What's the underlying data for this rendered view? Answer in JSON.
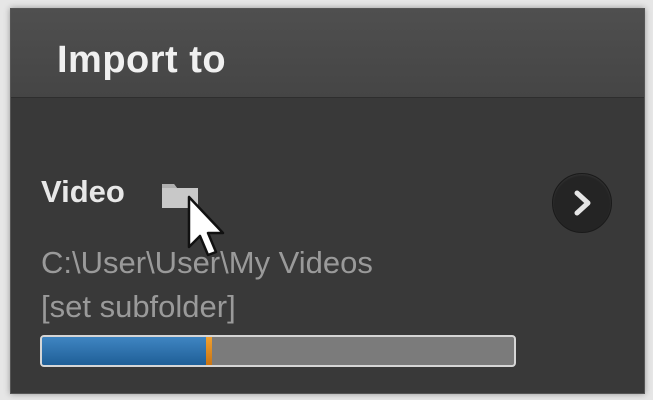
{
  "panel": {
    "title": "Import to"
  },
  "video": {
    "label": "Video",
    "folder_icon": "folder-icon",
    "path": "C:\\User\\User\\My Videos",
    "subfolder_link": "[set subfolder]",
    "expand_icon": "chevron-right-icon",
    "progress_fraction": 0.36
  },
  "colors": {
    "panel_bg": "#393939",
    "progress_fill": "#2a72b0",
    "progress_marker": "#e08a22",
    "progress_track": "#7b7b7b"
  }
}
